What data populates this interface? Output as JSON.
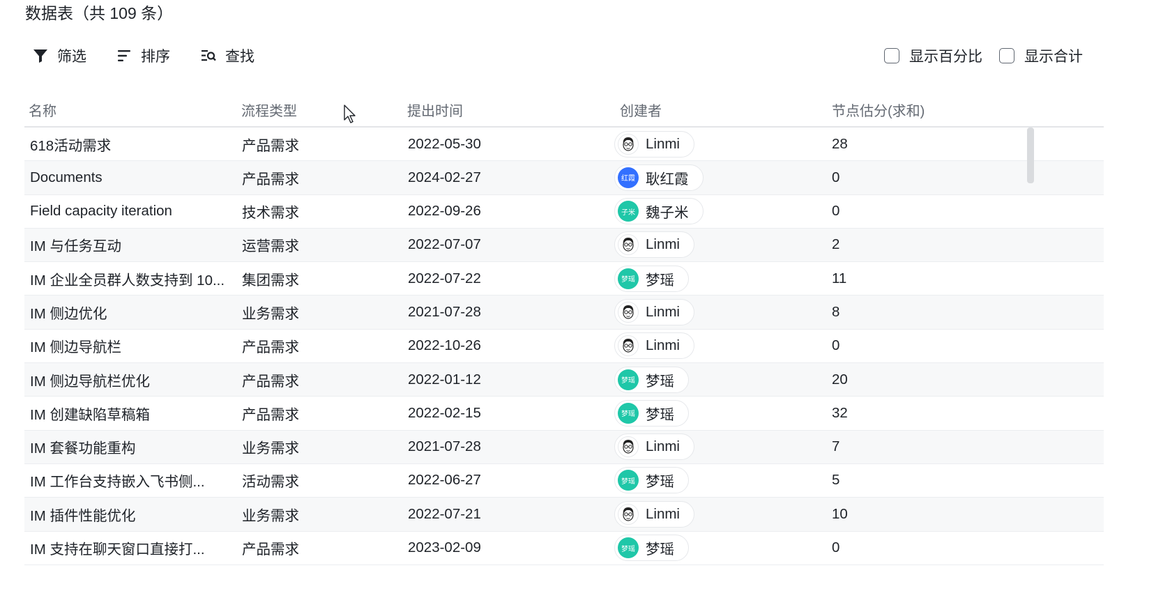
{
  "title": "数据表（共 109 条）",
  "toolbar": {
    "filter": "筛选",
    "sort": "排序",
    "find": "查找",
    "show_percent": "显示百分比",
    "show_total": "显示合计"
  },
  "columns": [
    "名称",
    "流程类型",
    "提出时间",
    "创建者",
    "节点估分(求和)"
  ],
  "rows": [
    {
      "name": "618活动需求",
      "type": "产品需求",
      "date": "2022-05-30",
      "creator": "Linmi",
      "avatar": "face",
      "score": "28"
    },
    {
      "name": "Documents",
      "type": "产品需求",
      "date": "2024-02-27",
      "creator": "耿红霞",
      "avatar": "blue",
      "avatar_text": "红霞",
      "score": "0"
    },
    {
      "name": "Field capacity iteration",
      "type": "技术需求",
      "date": "2022-09-26",
      "creator": "魏子米",
      "avatar": "green",
      "avatar_text": "子米",
      "score": "0"
    },
    {
      "name": "IM 与任务互动",
      "type": "运营需求",
      "date": "2022-07-07",
      "creator": "Linmi",
      "avatar": "face",
      "score": "2"
    },
    {
      "name": "IM 企业全员群人数支持到 10...",
      "type": "集团需求",
      "date": "2022-07-22",
      "creator": "梦瑶",
      "avatar": "green",
      "avatar_text": "梦瑶",
      "score": "11"
    },
    {
      "name": "IM 侧边优化",
      "type": "业务需求",
      "date": "2021-07-28",
      "creator": "Linmi",
      "avatar": "face",
      "score": "8"
    },
    {
      "name": "IM 侧边导航栏",
      "type": "产品需求",
      "date": "2022-10-26",
      "creator": "Linmi",
      "avatar": "face",
      "score": "0"
    },
    {
      "name": "IM 侧边导航栏优化",
      "type": "产品需求",
      "date": "2022-01-12",
      "creator": "梦瑶",
      "avatar": "green",
      "avatar_text": "梦瑶",
      "score": "20"
    },
    {
      "name": "IM 创建缺陷草稿箱",
      "type": "产品需求",
      "date": "2022-02-15",
      "creator": "梦瑶",
      "avatar": "green",
      "avatar_text": "梦瑶",
      "score": "32"
    },
    {
      "name": "IM 套餐功能重构",
      "type": "业务需求",
      "date": "2021-07-28",
      "creator": "Linmi",
      "avatar": "face",
      "score": "7"
    },
    {
      "name": "IM 工作台支持嵌入飞书侧...",
      "type": "活动需求",
      "date": "2022-06-27",
      "creator": "梦瑶",
      "avatar": "green",
      "avatar_text": "梦瑶",
      "score": "5"
    },
    {
      "name": "IM 插件性能优化",
      "type": "业务需求",
      "date": "2022-07-21",
      "creator": "Linmi",
      "avatar": "face",
      "score": "10"
    },
    {
      "name": "IM 支持在聊天窗口直接打...",
      "type": "产品需求",
      "date": "2023-02-09",
      "creator": "梦瑶",
      "avatar": "green",
      "avatar_text": "梦瑶",
      "score": "0"
    }
  ]
}
